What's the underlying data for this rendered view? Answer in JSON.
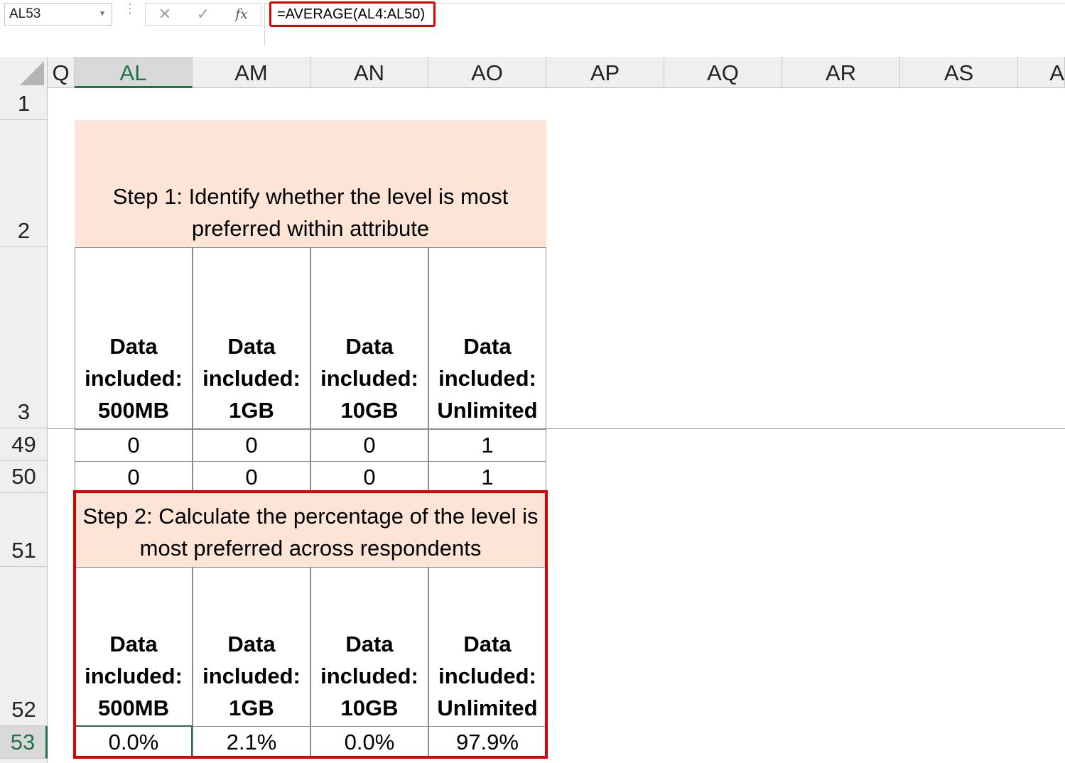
{
  "name_box": {
    "value": "AL53"
  },
  "formula_bar": {
    "cancel_glyph": "✕",
    "enter_glyph": "✓",
    "fx_label": "fx",
    "formula": "=AVERAGE(AL4:AL50)"
  },
  "columns": [
    "Q",
    "AL",
    "AM",
    "AN",
    "AO",
    "AP",
    "AQ",
    "AR",
    "AS",
    "A"
  ],
  "active_column": "AL",
  "rows": [
    "1",
    "2",
    "3",
    "49",
    "50",
    "51",
    "52",
    "53"
  ],
  "active_row": "53",
  "step1": {
    "text": "Step 1: Identify whether the level is most preferred within attribute"
  },
  "step2": {
    "text": "Step 2: Calculate the percentage of the level is most preferred across respondents"
  },
  "headers": [
    {
      "line1": "Data",
      "line2": "included:",
      "line3": "500MB"
    },
    {
      "line1": "Data",
      "line2": "included:",
      "line3": "1GB"
    },
    {
      "line1": "Data",
      "line2": "included:",
      "line3": "10GB"
    },
    {
      "line1": "Data",
      "line2": "included:",
      "line3": "Unlimited"
    }
  ],
  "row49": [
    "0",
    "0",
    "0",
    "1"
  ],
  "row50": [
    "0",
    "0",
    "0",
    "1"
  ],
  "row53": [
    "0.0%",
    "2.1%",
    "0.0%",
    "97.9%"
  ]
}
